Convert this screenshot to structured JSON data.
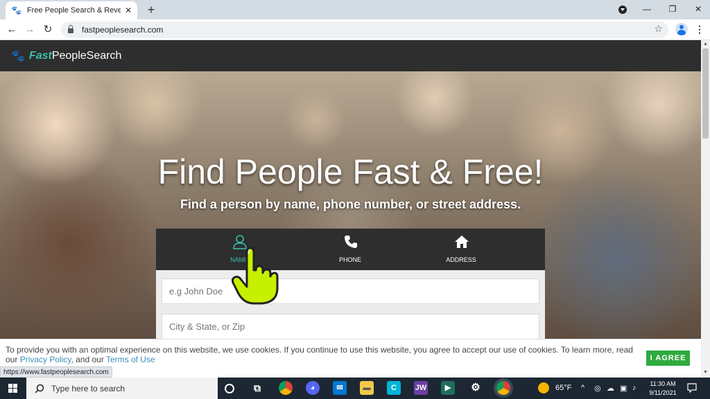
{
  "browser": {
    "tab_title": "Free People Search & Reverse Ph",
    "tab_close": "✕",
    "new_tab": "+",
    "url": "fastpeoplesearch.com",
    "win_minimize": "—",
    "win_restore": "❐",
    "win_close": "✕"
  },
  "site": {
    "logo_fast": "Fast",
    "logo_rest": "PeopleSearch",
    "hero_title": "Find People Fast & Free!",
    "hero_subtitle": "Find a person by name, phone number, or street address.",
    "tabs": [
      {
        "label": "NAME",
        "icon": "user-icon",
        "active": true
      },
      {
        "label": "PHONE",
        "icon": "phone-icon",
        "active": false
      },
      {
        "label": "ADDRESS",
        "icon": "house-icon",
        "active": false
      }
    ],
    "name_placeholder": "e.g John Doe",
    "location_placeholder": "City & State, or Zip"
  },
  "cookie": {
    "text_before": "To provide you with an optimal experience on this website, we use cookies. If you continue to use this website, you agree to accept our use of cookies. To learn more, read our ",
    "privacy_link": "Privacy Policy",
    "middle": ", and our ",
    "terms_link": "Terms of Use",
    "agree_label": "I AGREE"
  },
  "status_url": "https://www.fastpeoplesearch.com",
  "taskbar": {
    "search_text": "Type here to search",
    "weather": "65°F",
    "time": "11:30 AM",
    "date": "9/11/2021"
  },
  "colors": {
    "accent": "#3cbfae",
    "header_bg": "#2e2e2e",
    "agree_green": "#2eab3f",
    "cursor_yellow": "#c6f000"
  }
}
